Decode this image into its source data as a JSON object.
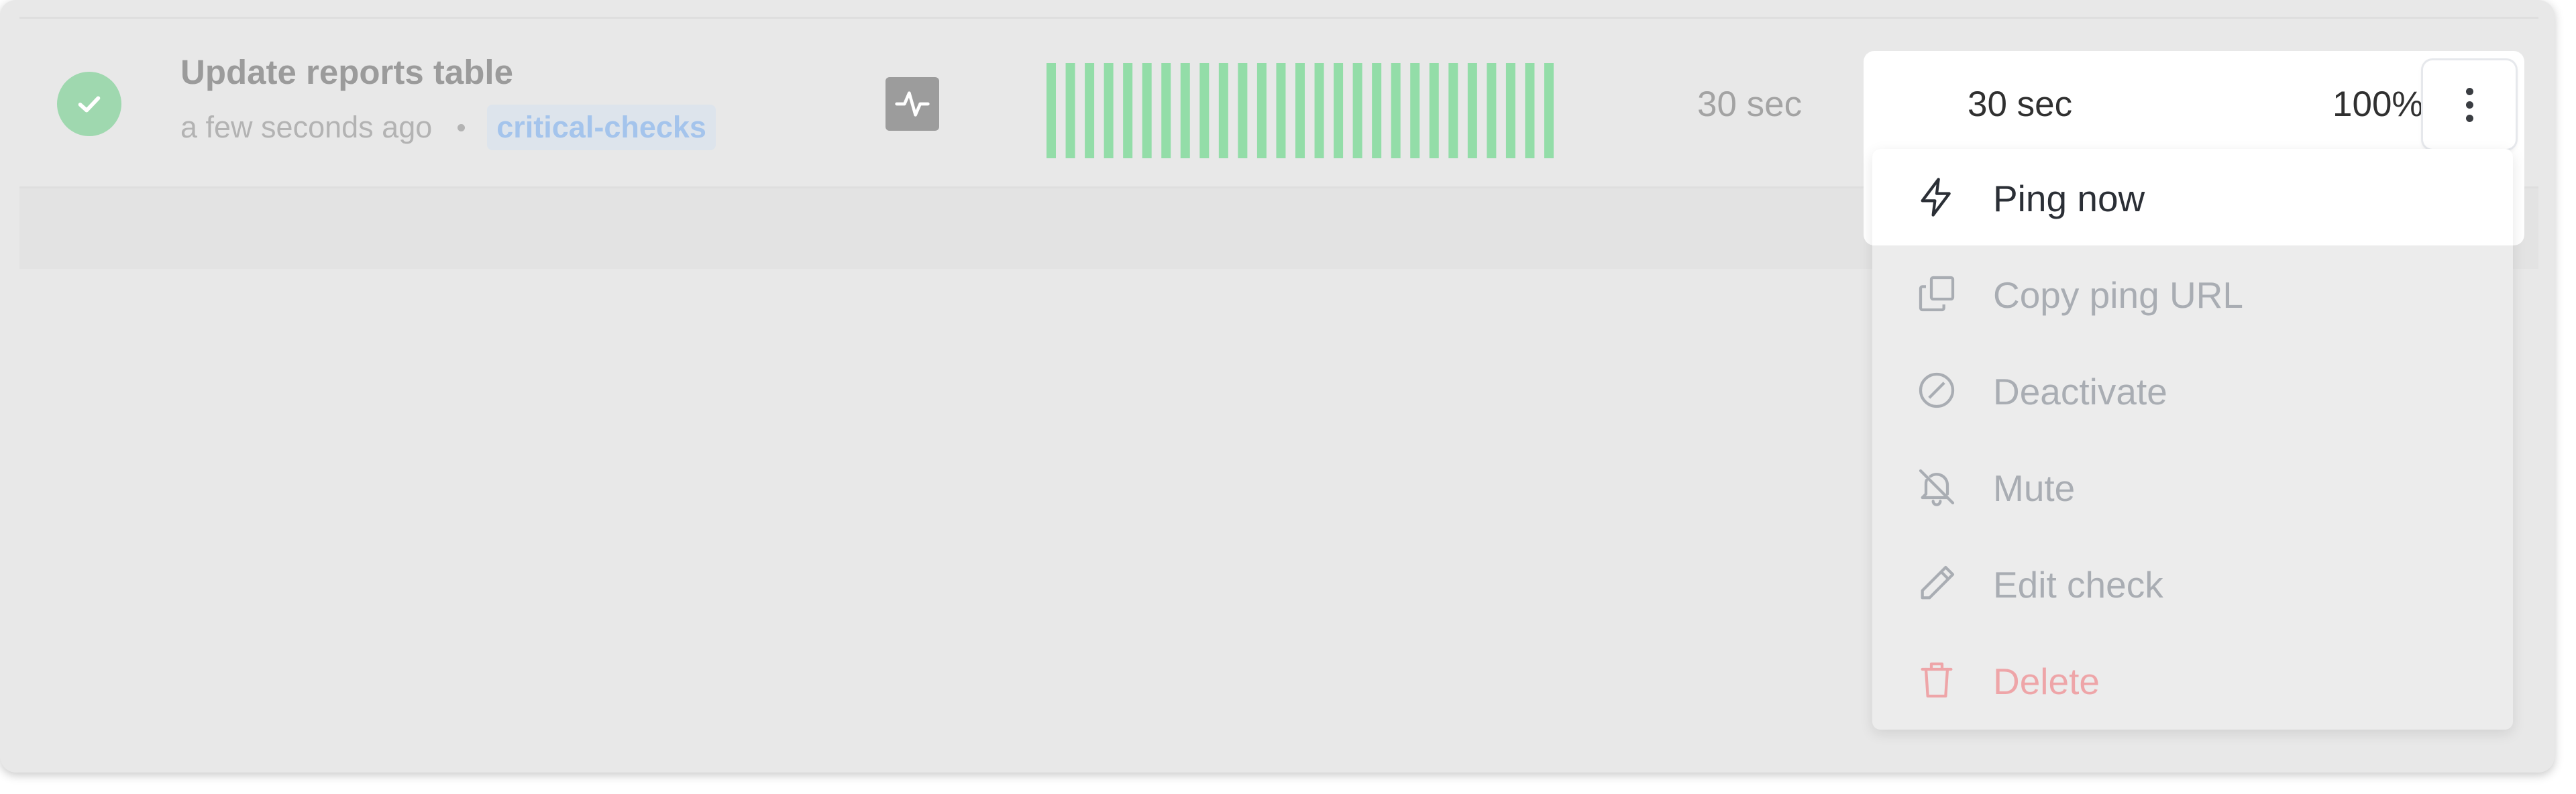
{
  "check": {
    "name": "Update reports table",
    "last_ping": "a few seconds ago",
    "tag": "critical-checks",
    "status": "up",
    "period": "30 sec",
    "grace": "30 sec",
    "uptime": "100%",
    "sparkline_bars": 27
  },
  "colors": {
    "status_up": "#9fd8af",
    "sparkline": "#93dda8",
    "tag_text": "#a4c4ec",
    "danger": "#eea5a8"
  },
  "menu": {
    "items": [
      {
        "label": "Ping now",
        "icon": "bolt-icon"
      },
      {
        "label": "Copy ping URL",
        "icon": "copy-icon"
      },
      {
        "label": "Deactivate",
        "icon": "ban-icon"
      },
      {
        "label": "Mute",
        "icon": "bell-off-icon"
      },
      {
        "label": "Edit check",
        "icon": "pencil-icon"
      },
      {
        "label": "Delete",
        "icon": "trash-icon"
      }
    ]
  }
}
